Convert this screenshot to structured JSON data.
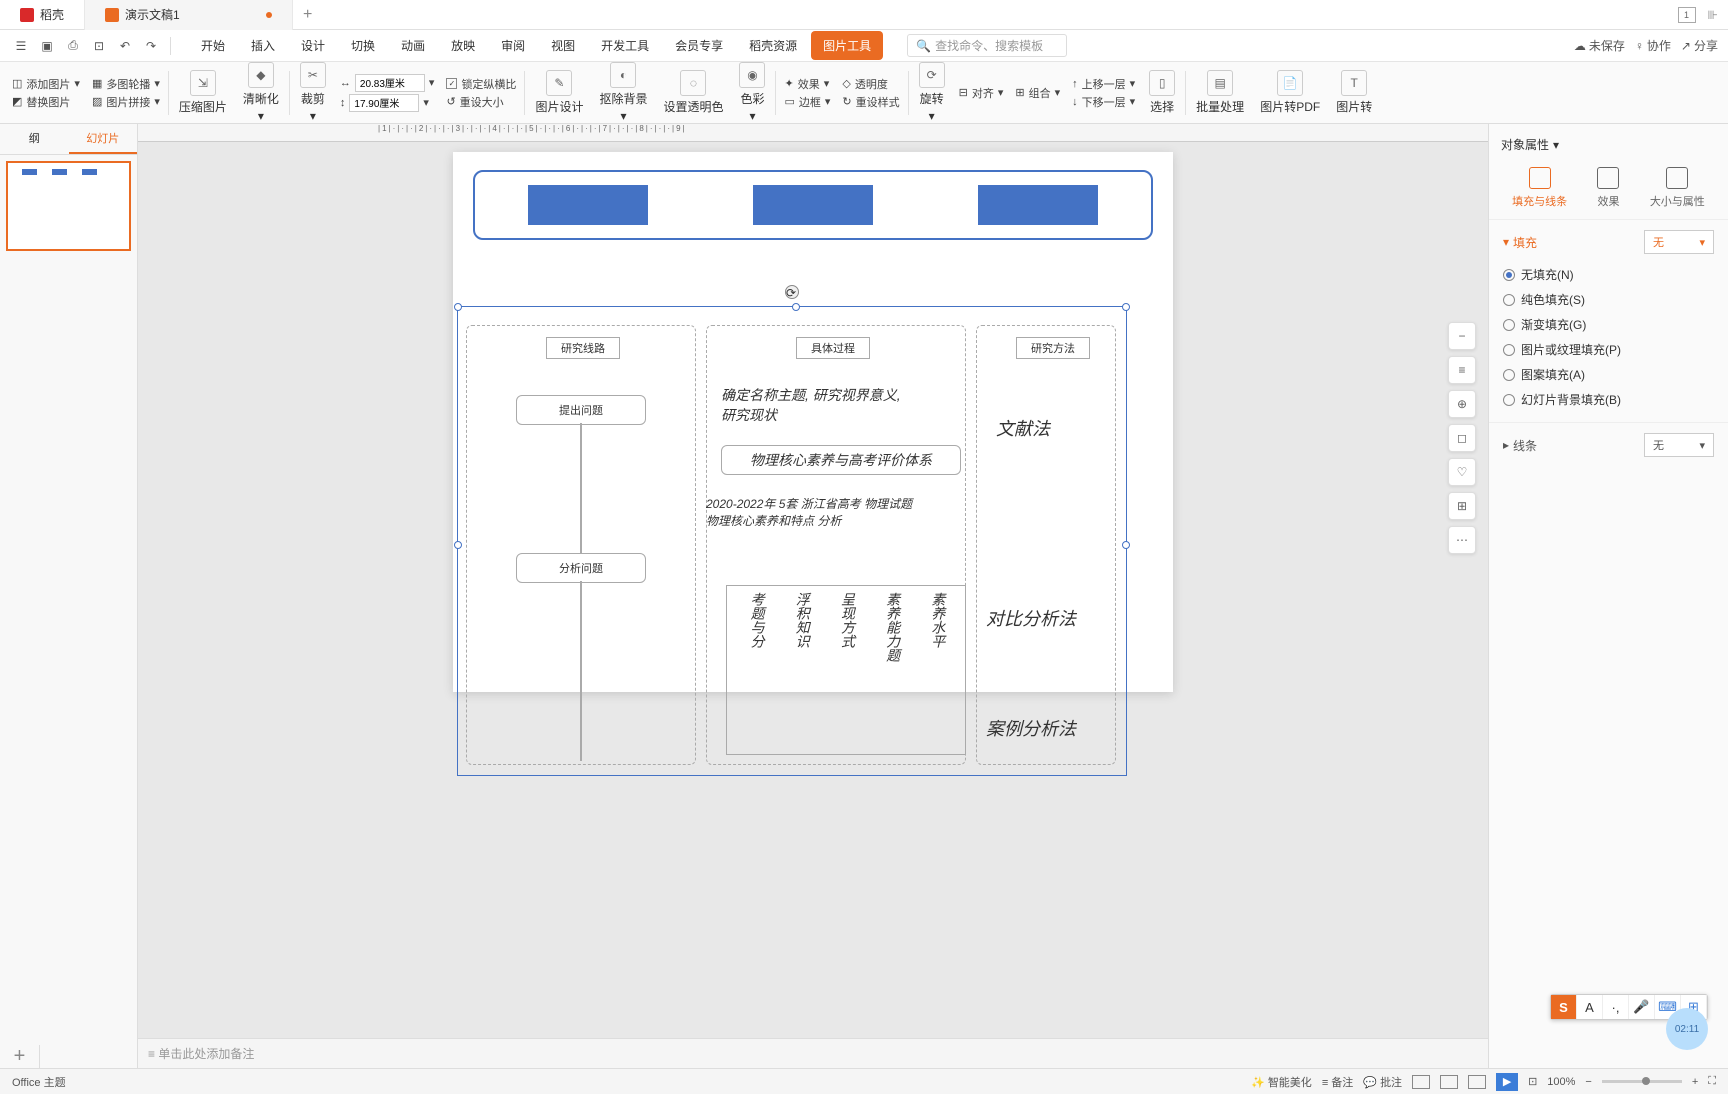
{
  "titlebar": {
    "tab1": "稻壳",
    "tab2": "演示文稿1",
    "new_tab": "+"
  },
  "quickaccess": {
    "menu": [
      "开始",
      "插入",
      "设计",
      "切换",
      "动画",
      "放映",
      "审阅",
      "视图",
      "开发工具",
      "会员专享",
      "稻壳资源"
    ],
    "highlight": "图片工具",
    "search_placeholder": "查找命令、搜索模板",
    "unsaved": "未保存",
    "collab": "协作",
    "share": "分享"
  },
  "ribbon": {
    "add_image": "添加图片",
    "replace_image": "替换图片",
    "carousel": "多图轮播",
    "image_merge": "图片拼接",
    "compress": "压缩图片",
    "sharpen": "清晰化",
    "crop": "裁剪",
    "width": "20.83厘米",
    "height": "17.90厘米",
    "lock_ratio": "锁定纵横比",
    "reset_size": "重设大小",
    "image_design": "图片设计",
    "remove_bg": "抠除背景",
    "set_transparent": "设置透明色",
    "color": "色彩",
    "effect": "效果",
    "border": "边框",
    "opacity": "透明度",
    "reset_style": "重设样式",
    "rotate": "旋转",
    "align": "对齐",
    "group": "组合",
    "bring_fwd": "上移一层",
    "send_back": "下移一层",
    "select": "选择",
    "batch": "批量处理",
    "to_pdf": "图片转PDF",
    "to_text": "图片转"
  },
  "sidebar": {
    "tab_outline": "纲",
    "tab_slides": "幻灯片"
  },
  "slide": {
    "col1": "研究线路",
    "col2": "具体过程",
    "col3": "研究方法",
    "box1": "提出问题",
    "box2": "分析问题",
    "hand1": "确定名称主题, 研究视界意义,",
    "hand1b": "研究现状",
    "hand2": "物理核心素养与高考评价体系",
    "hand3": "2020-2022年 5套 浙江省高考 物理试题",
    "hand3b": "物理核心素养和特点 分析",
    "method1": "文献法",
    "method2": "对比分析法",
    "method3": "案例分析法",
    "grid1": "考题与分",
    "grid2": "浮积知识",
    "grid3": "呈现方式",
    "grid4": "素养能力题",
    "grid5": "素养水平"
  },
  "float": {
    "minus": "−",
    "layers": "≡",
    "zoom": "⊕",
    "crop": "◻",
    "idea": "♡",
    "grid": "⊞",
    "more": "⋯"
  },
  "panel": {
    "title": "对象属性",
    "tab_fill": "填充与线条",
    "tab_effect": "效果",
    "tab_size": "大小与属性",
    "fill_header": "填充",
    "fill_none_select": "无",
    "radio_none": "无填充(N)",
    "radio_solid": "纯色填充(S)",
    "radio_gradient": "渐变填充(G)",
    "radio_picture": "图片或纹理填充(P)",
    "radio_pattern": "图案填充(A)",
    "radio_slidebg": "幻灯片背景填充(B)",
    "line_header": "线条",
    "line_none": "无"
  },
  "notes": {
    "placeholder": "单击此处添加备注"
  },
  "statusbar": {
    "theme": "Office 主题",
    "beautify": "智能美化",
    "notes_btn": "备注",
    "comments": "批注",
    "zoom": "100%"
  },
  "ime": {
    "s": "S",
    "a": "A"
  },
  "timer": "02:11"
}
